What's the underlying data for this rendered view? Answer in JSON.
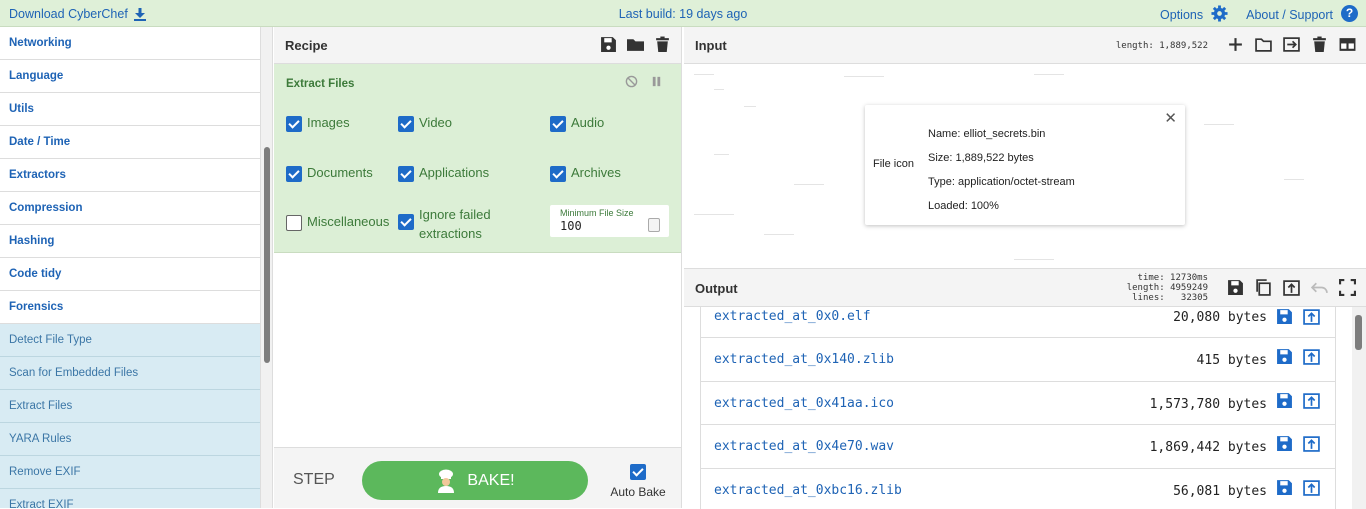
{
  "banner": {
    "download_label": "Download CyberChef",
    "last_build": "Last build: 19 days ago",
    "options_label": "Options",
    "about_label": "About / Support",
    "help_glyph": "?"
  },
  "operations": {
    "categories": [
      "Networking",
      "Language",
      "Utils",
      "Date / Time",
      "Extractors",
      "Compression",
      "Hashing",
      "Code tidy",
      "Forensics"
    ],
    "forensics_ops": [
      "Detect File Type",
      "Scan for Embedded Files",
      "Extract Files",
      "YARA Rules",
      "Remove EXIF",
      "Extract EXIF"
    ]
  },
  "recipe": {
    "title": "Recipe",
    "operation": {
      "name": "Extract Files",
      "options": [
        {
          "label": "Images",
          "checked": true
        },
        {
          "label": "Video",
          "checked": true
        },
        {
          "label": "Audio",
          "checked": true
        },
        {
          "label": "Documents",
          "checked": true
        },
        {
          "label": "Applications",
          "checked": true
        },
        {
          "label": "Archives",
          "checked": true
        },
        {
          "label": "Miscellaneous",
          "checked": false
        },
        {
          "label": "Ignore failed extractions",
          "checked": true
        }
      ],
      "min_size_label": "Minimum File Size",
      "min_size_value": "100"
    },
    "step_label": "STEP",
    "bake_label": "BAKE!",
    "autobake_label": "Auto Bake",
    "autobake_checked": true
  },
  "input": {
    "title": "Input",
    "length": "length: 1,889,522",
    "file": {
      "icon_label": "File icon",
      "name": "Name: elliot_secrets.bin",
      "size": "Size: 1,889,522 bytes",
      "type": "Type: application/octet-stream",
      "loaded": "Loaded: 100%"
    }
  },
  "output": {
    "title": "Output",
    "time": "time: 12730ms",
    "length": "length: 4959249",
    "lines": "lines:   32305",
    "files": [
      {
        "name": "extracted_at_0x0.elf",
        "size": "20,080 bytes"
      },
      {
        "name": "extracted_at_0x140.zlib",
        "size": "415 bytes"
      },
      {
        "name": "extracted_at_0x41aa.ico",
        "size": "1,573,780 bytes"
      },
      {
        "name": "extracted_at_0x4e70.wav",
        "size": "1,869,442 bytes"
      },
      {
        "name": "extracted_at_0xbc16.zlib",
        "size": "56,081 bytes"
      }
    ]
  },
  "colors": {
    "banner_bg": "#dff0d8",
    "link_blue": "#1e63b5",
    "op_card_bg": "#dcefd6",
    "op_text_green": "#3c7a3a",
    "bake_green": "#5cb85c",
    "checkbox_blue": "#1e6bc8",
    "forensics_op_bg": "#d8ebf3"
  },
  "icons": [
    "download-icon",
    "gear-icon",
    "help-icon",
    "save-icon",
    "folder-icon",
    "trash-icon",
    "disable-icon",
    "pause-icon",
    "plus-icon",
    "open-folder-icon",
    "open-file-icon",
    "layout-icon",
    "copy-icon",
    "replace-input-icon",
    "undo-icon",
    "maximise-icon",
    "close-icon",
    "chef-icon"
  ]
}
